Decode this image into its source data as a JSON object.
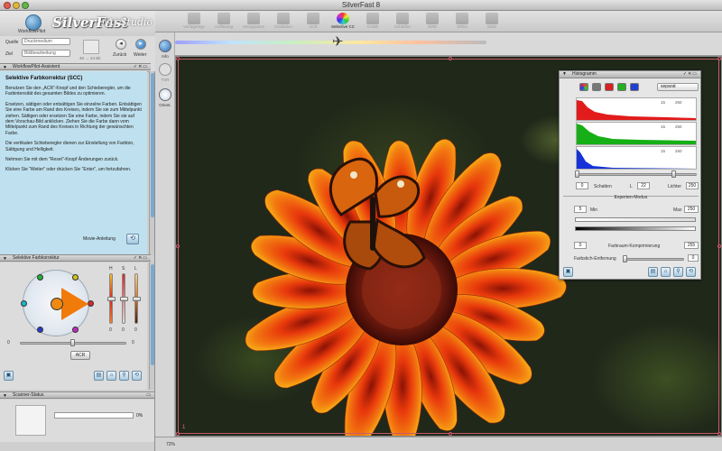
{
  "window": {
    "title": "SilverFast 8"
  },
  "brand": {
    "logo_label": "WorkflowPilot",
    "name": "SilverFast",
    "studio": "Ai Studio"
  },
  "source": {
    "quelle_label": "Quelle",
    "quelle_value": "Druckmedium",
    "ziel_label": "Ziel",
    "ziel_value": "Bildbearbeitung",
    "bit_info": "48 → 24 Bit",
    "back_label": "Zurück",
    "next_label": "Weiter"
  },
  "assistant": {
    "header": "WorkflowPilot-Assistent",
    "title": "Selektive Farbkorrektur (SCC)",
    "paragraphs": [
      "Benutzen Sie den „ACR“-Knopf und den Schieberegler, um die Farbintensität des gesamten Bildes zu optimieren.",
      "Ersetzen, sättigen oder entsättigen Sie einzelne Farben. Entsättigen Sie eine Farbe am Rand des Kreises, indem Sie sie zum Mittelpunkt ziehen. Sättigen oder ersetzen Sie eine Farbe, indem Sie sie auf dem Vorschau-Bild anklicken. Ziehen Sie die Farbe dann vom Mittelpunkt zum Rand des Kreises in Richtung der gewünschten Farbe.",
      "Die vertikalen Schieberegler dienen zur Einstellung von Farbton, Sättigung und Helligkeit.",
      "Nehmen Sie mit dem \"Reset\"-Knopf Änderungen zurück.",
      "Klicken Sie \"Weiter\" oder drücken Sie \"Enter\", um fortzufahren."
    ],
    "movie_label": "Movie-Anleitung"
  },
  "scc": {
    "header": "Selektive Farbkorrektur",
    "slider_labels": [
      "H",
      "S",
      "L"
    ],
    "slider_values": [
      "0",
      "0",
      "0"
    ],
    "bottom_min": "0",
    "bottom_max": "0",
    "acr_label": "ACR",
    "bottom_slider_level": 0.5,
    "dot_colors": [
      "#1fb33a",
      "#d4c21c",
      "#19b8c8",
      "#d62a2a",
      "#2a3ad0",
      "#c02ac4"
    ]
  },
  "scanner": {
    "header": "Scanner-Status",
    "progress_text": "0%",
    "progress": 0
  },
  "toolbar": {
    "tools": [
      "Vorlagentyp",
      "Auflösung",
      "Histogramm",
      "Gradation",
      "ACR",
      "Selective CC",
      "GANE",
      "Schärfen",
      "iSRD",
      "SRDx",
      "Multi"
    ],
    "active_index": 5
  },
  "side_tools": {
    "info_label": "Info",
    "tsr_label": "TSR",
    "orient_label": "Orient."
  },
  "preview": {
    "crop_number": "1"
  },
  "status": {
    "zoom": "72%"
  },
  "histogram": {
    "title": "Histogramm",
    "mode": "separat",
    "channel_colors": [
      "#777777",
      "#d82020",
      "#20b020",
      "#2040d0"
    ],
    "graph_max": [
      "250",
      "250",
      "250"
    ],
    "graph_mid": [
      "15",
      "15",
      "15"
    ],
    "shadow_value": "0",
    "shadow_label": "Schatten",
    "mid_label": "L",
    "mid_value": "22",
    "light_label": "Lichter",
    "light_value": "250",
    "expert_label": "Experten-Modus",
    "min_label": "Min",
    "min_value": "5",
    "max_label": "Max",
    "max_value": "250",
    "compress_min": "0",
    "compress_label": "Farbraum-Komprimierung",
    "compress_max": "255",
    "cast_label": "Farbstich-Entfernung",
    "cast_value": "0"
  }
}
